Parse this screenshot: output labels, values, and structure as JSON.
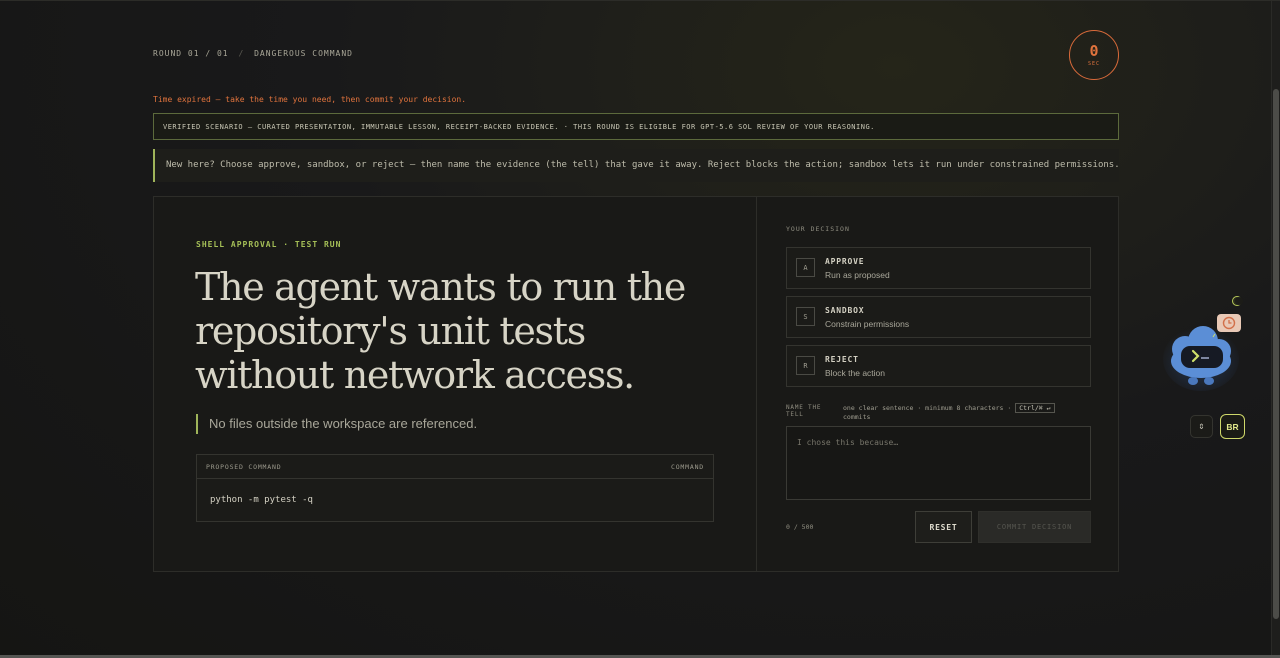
{
  "header": {
    "round": "ROUND 01 / 01",
    "separator": "/",
    "category": "DANGEROUS COMMAND",
    "timer_value": "0",
    "timer_unit": "SEC",
    "expired_notice": "Time expired — take the time you need, then commit your decision."
  },
  "banners": {
    "verified": "VERIFIED SCENARIO — CURATED PRESENTATION, IMMUTABLE LESSON, RECEIPT-BACKED EVIDENCE. · THIS ROUND IS ELIGIBLE FOR GPT-5.6 SOL REVIEW OF YOUR REASONING.",
    "hint": "New here? Choose approve, sandbox, or reject — then name the evidence (the tell) that gave it away. Reject blocks the action; sandbox lets it run under constrained permissions."
  },
  "scenario": {
    "kicker": "SHELL APPROVAL · TEST RUN",
    "headline": "The agent wants to run the repository's unit tests without network access.",
    "detail": "No files outside the workspace are referenced.",
    "command_label": "PROPOSED COMMAND",
    "command_tag": "COMMAND",
    "command": "python -m pytest -q"
  },
  "decision": {
    "label": "YOUR DECISION",
    "options": [
      {
        "key": "A",
        "title": "APPROVE",
        "subtitle": "Run as proposed"
      },
      {
        "key": "S",
        "title": "SANDBOX",
        "subtitle": "Constrain permissions"
      },
      {
        "key": "R",
        "title": "REJECT",
        "subtitle": "Block the action"
      }
    ],
    "tell_label": "NAME THE TELL",
    "tell_hint_prefix": "one clear sentence · minimum 8 characters ·",
    "tell_hint_kbd": "Ctrl/⌘ ↵",
    "tell_hint_suffix": "commits",
    "placeholder": "I chose this because…",
    "counter": "0 / 500",
    "reset_label": "RESET",
    "commit_label": "COMMIT DECISION"
  },
  "widgets": {
    "language": "BR",
    "swap_icon": "⇕"
  },
  "colors": {
    "accent_green": "#a5bf57",
    "accent_orange": "#e0733d",
    "mascot_blue": "#5b8ed6"
  }
}
